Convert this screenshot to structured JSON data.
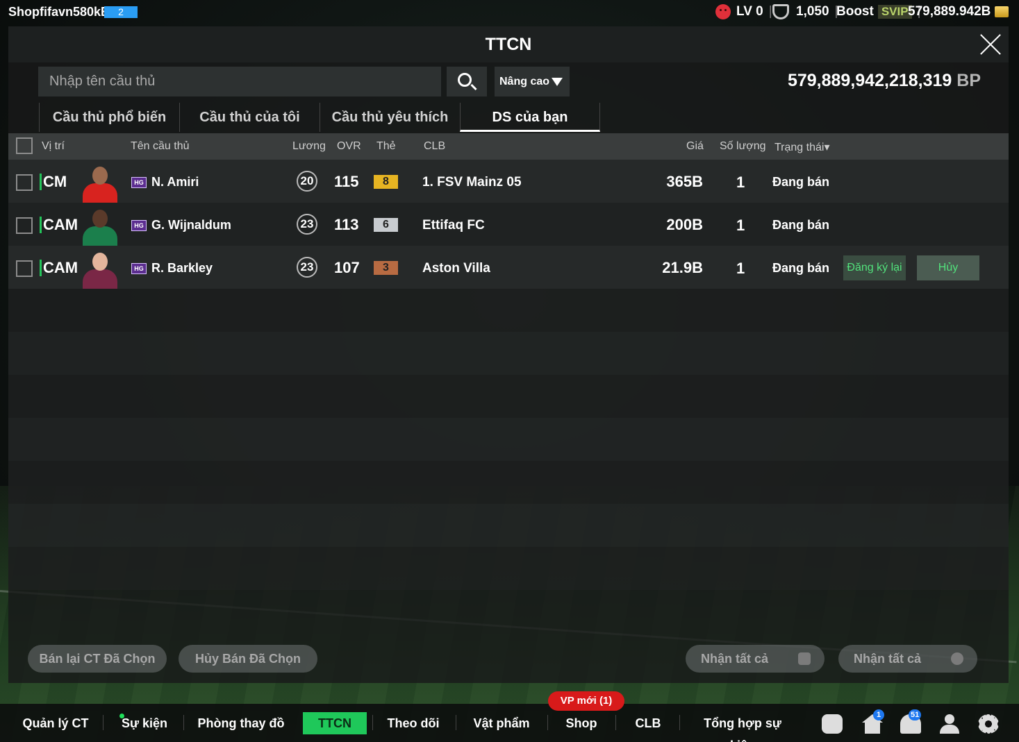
{
  "top_bar": {
    "username": "Shopfifavn580kB",
    "user_badge": "2",
    "level": "LV 0",
    "points": "1,050",
    "boost_label": "Boost",
    "svip_label": "SVIP",
    "balance": "579,889.942B",
    "icons": [
      "sad-face-icon",
      "shield-icon",
      "gold-bars-icon"
    ]
  },
  "modal": {
    "title": "TTCN",
    "search": {
      "placeholder": "Nhập tên cầu thủ",
      "value": ""
    },
    "advanced_label": "Nâng cao",
    "bp_value": "579,889,942,218,319",
    "bp_unit": "BP",
    "tabs": [
      {
        "label": "Cầu thủ phổ biến",
        "active": false
      },
      {
        "label": "Cầu thủ của tôi",
        "active": false
      },
      {
        "label": "Cầu thủ yêu thích",
        "active": false
      },
      {
        "label": "DS của bạn",
        "active": true
      }
    ]
  },
  "table": {
    "headers": {
      "position": "Vị trí",
      "name": "Tên cầu thủ",
      "wage": "Lương",
      "ovr": "OVR",
      "card": "Thẻ",
      "club": "CLB",
      "price": "Giá",
      "quantity": "Số lượng",
      "status": "Trạng thái▾"
    },
    "rows": [
      {
        "position": "CM",
        "badge": "HG",
        "name": "N. Amiri",
        "wage": "20",
        "ovr": "115",
        "grade": "8",
        "club": "1. FSV Mainz 05",
        "price": "365B",
        "quantity": "1",
        "status": "Đang bán"
      },
      {
        "position": "CAM",
        "badge": "HG",
        "name": "G. Wijnaldum",
        "wage": "23",
        "ovr": "113",
        "grade": "6",
        "club": "Ettifaq FC",
        "price": "200B",
        "quantity": "1",
        "status": "Đang bán"
      },
      {
        "position": "CAM",
        "badge": "HG",
        "name": "R. Barkley",
        "wage": "23",
        "ovr": "107",
        "grade": "3",
        "club": "Aston Villa",
        "price": "21.9B",
        "quantity": "1",
        "status": "Đang bán",
        "relist_label": "Đăng ký lại",
        "cancel_label": "Hủy"
      }
    ]
  },
  "actions": {
    "resell_selected": "Bán lại CT Đã Chọn",
    "cancel_selected": "Hủy Bán Đã Chọn",
    "claim_all_1": "Nhận tất cả",
    "claim_all_2": "Nhận tất cả"
  },
  "nav": {
    "items": [
      "Quản lý CT",
      "Sự kiện",
      "Phòng thay đồ",
      "TTCN",
      "Theo dõi",
      "Vật phẩm",
      "Shop",
      "CLB",
      "Tổng hợp sự kiện"
    ],
    "active": "TTCN",
    "new_items_badge": "VP mới (1)",
    "home_badge": "1",
    "bell_badge": "51"
  },
  "colors": {
    "accent_green": "#1fc85a",
    "grade_gold": "#e6b422",
    "grade_silver": "#c8ccd0",
    "grade_bronze": "#b86b42",
    "badge_red": "#d81a1a"
  }
}
